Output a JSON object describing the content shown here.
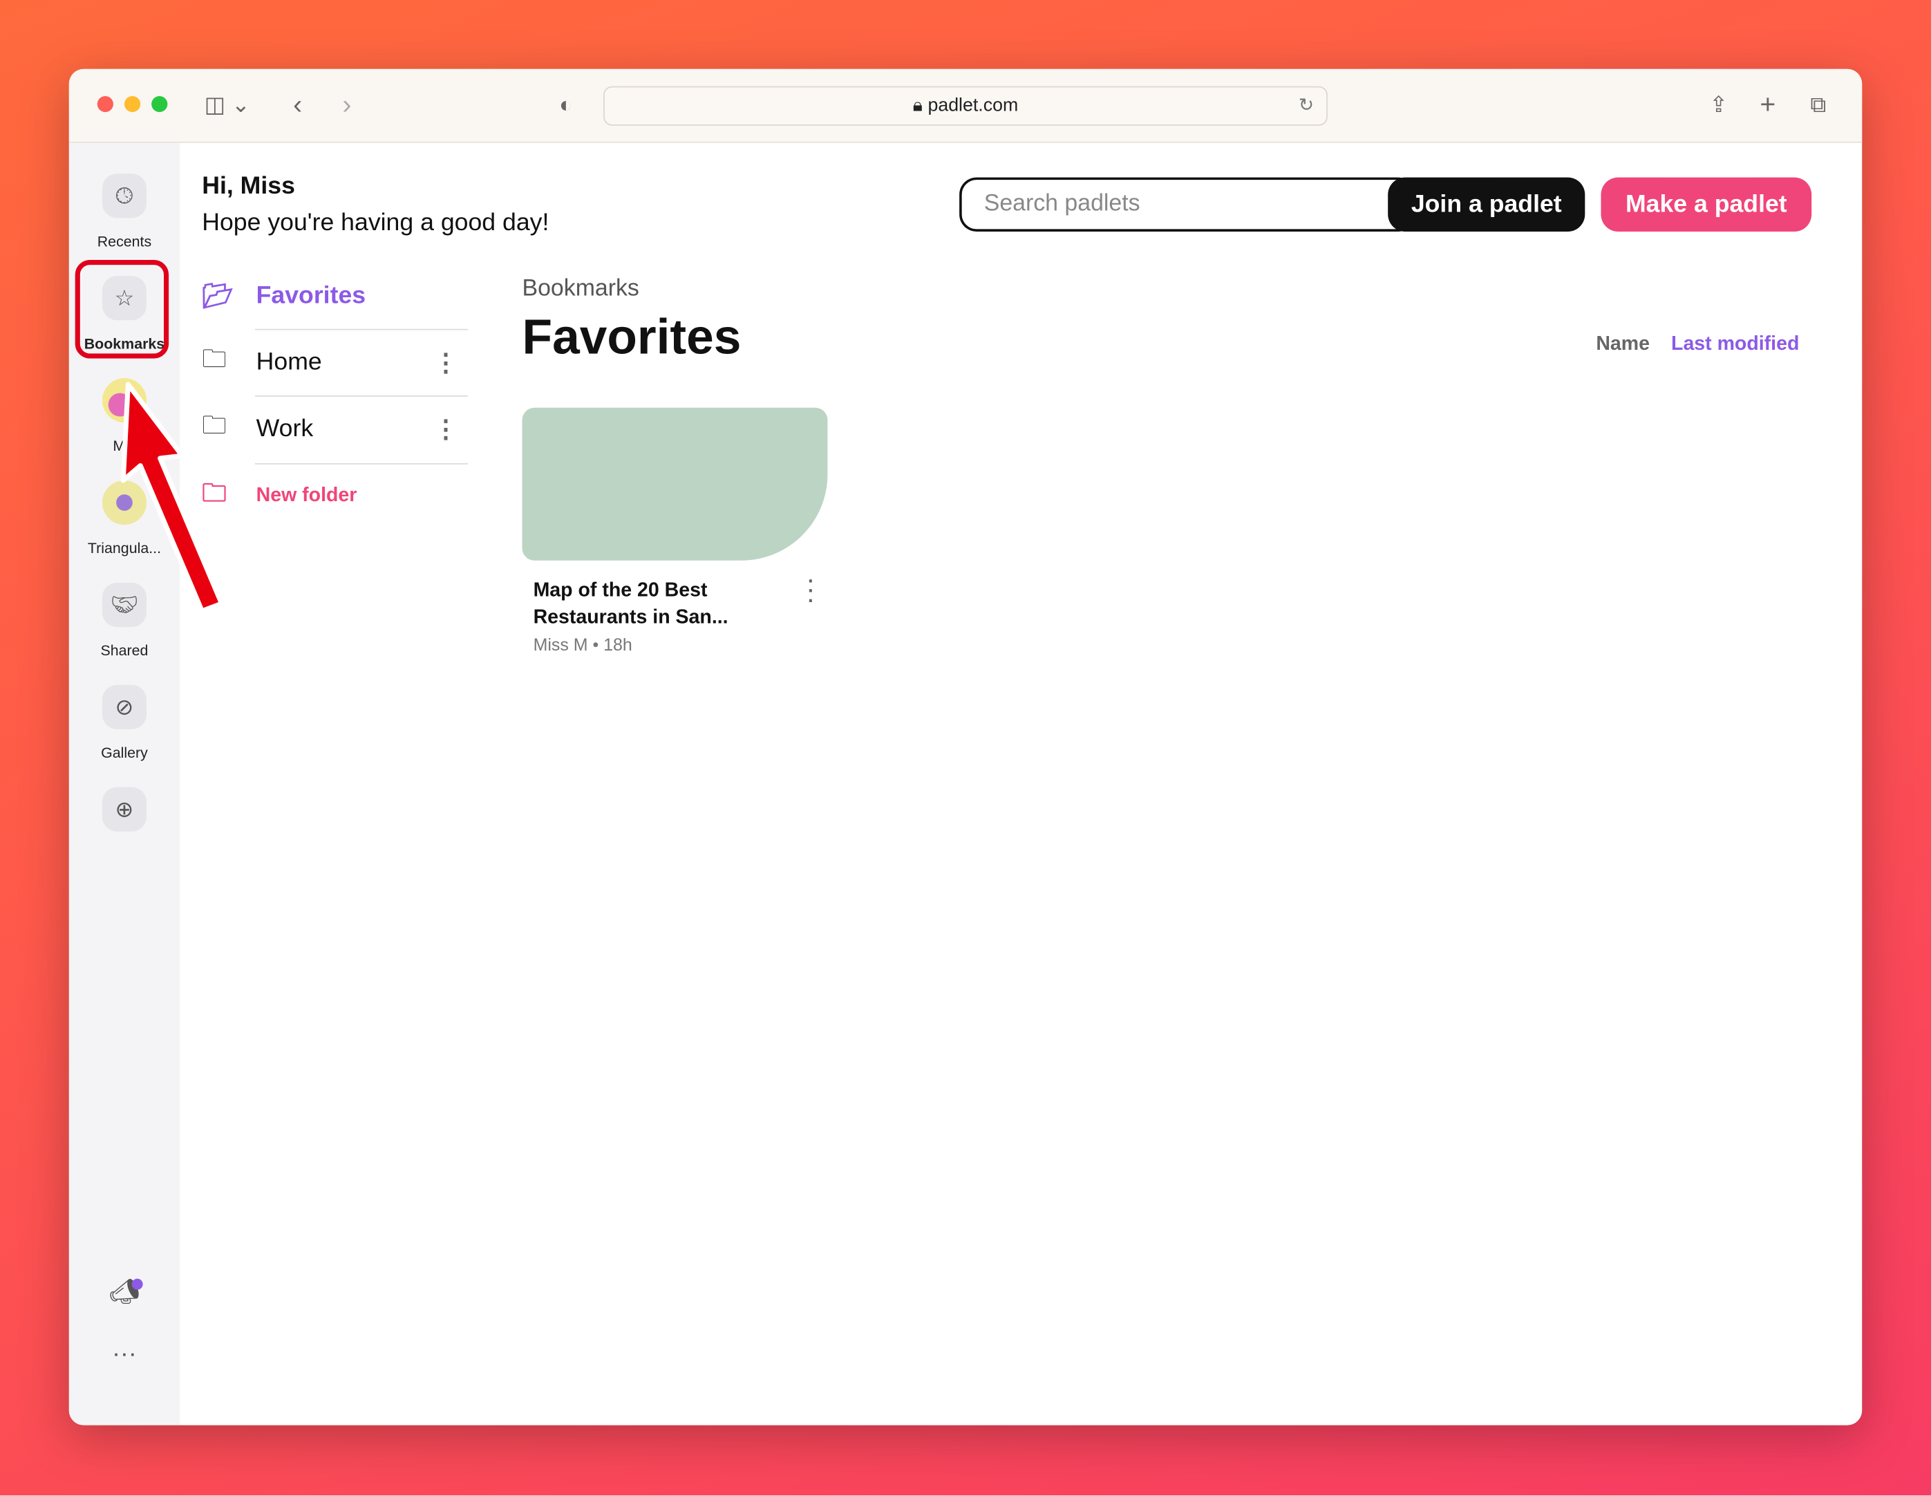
{
  "browser": {
    "url": "padlet.com"
  },
  "rail": {
    "items": [
      {
        "label": "Recents",
        "icon": "clock-icon"
      },
      {
        "label": "Bookmarks",
        "icon": "star-icon"
      },
      {
        "label": "Mis",
        "icon": "avatar"
      },
      {
        "label": "Triangula...",
        "icon": "avatar"
      },
      {
        "label": "Shared",
        "icon": "handshake-icon"
      },
      {
        "label": "Gallery",
        "icon": "compass-icon"
      }
    ]
  },
  "greeting": {
    "title": "Hi, Miss",
    "subtitle": "Hope you're having a good day!"
  },
  "header": {
    "search_placeholder": "Search padlets",
    "join_label": "Join a padlet",
    "make_label": "Make a padlet"
  },
  "folders": [
    {
      "label": "Favorites"
    },
    {
      "label": "Home"
    },
    {
      "label": "Work"
    }
  ],
  "new_folder_label": "New folder",
  "content": {
    "breadcrumb": "Bookmarks",
    "title": "Favorites",
    "sort": {
      "name": "Name",
      "last_modified": "Last modified",
      "active": "Last modified"
    }
  },
  "cards": [
    {
      "title": "Map of the 20 Best Restaurants in San...",
      "author": "Miss M",
      "age": "18h"
    }
  ],
  "colors": {
    "accent_purple": "#8c5ae6",
    "accent_pink": "#f0457a",
    "card_bg": "#bcd4c4",
    "annotation_red": "#e0001b"
  }
}
